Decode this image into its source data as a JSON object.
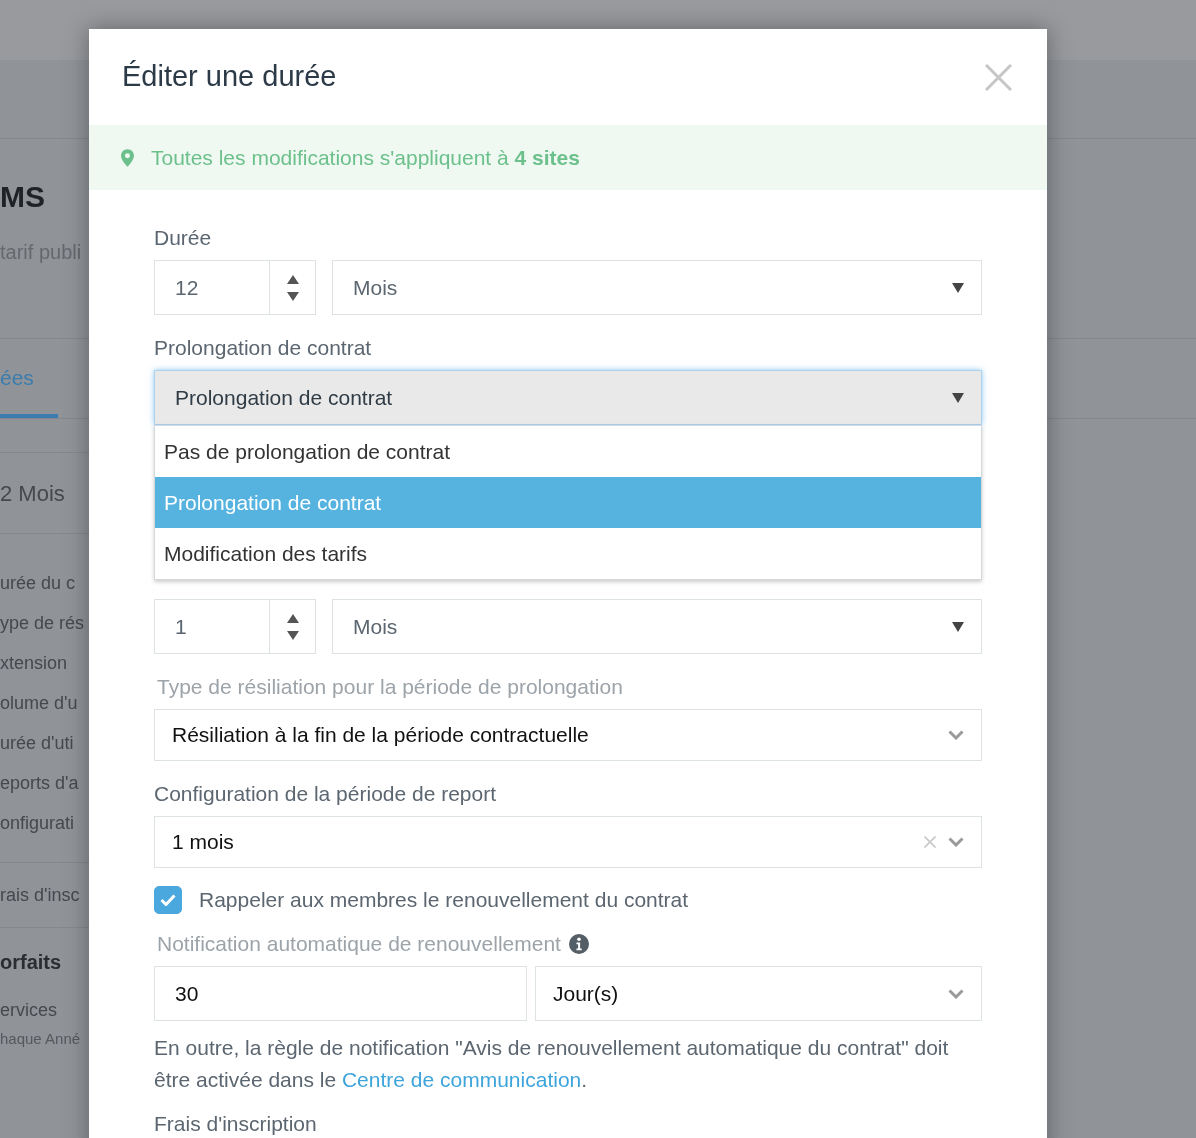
{
  "background": {
    "heading": "MS",
    "subheading": "tarif publi",
    "tab": {
      "label": "ées",
      "selected": true
    },
    "summary": "2 Mois",
    "details": [
      "urée du c",
      "ype de rés",
      "xtension",
      "olume d'u",
      "urée d'uti",
      "eports d'a",
      "onfigurati"
    ],
    "fee": "rais d'insc",
    "section": "orfaits",
    "service": "ervices",
    "service_note": "haque Anné"
  },
  "dialog": {
    "title": "Éditer une durée",
    "banner": "Toutes les modifications s'appliquent à **4 sites**",
    "fields": [
      {
        "kind": "number_unit",
        "label": "Durée",
        "muted": false,
        "value": "12",
        "unit": "Mois"
      },
      {
        "kind": "select_open",
        "label": "Prolongation de contrat",
        "muted": false,
        "value": "Prolongation de contrat",
        "options": [
          {
            "label": "Pas de prolongation de contrat",
            "selected": false
          },
          {
            "label": "Prolongation de contrat",
            "selected": true
          },
          {
            "label": "Modification des tarifs",
            "selected": false
          }
        ]
      },
      {
        "kind": "number_unit",
        "value": "1",
        "unit": "Mois"
      },
      {
        "kind": "select",
        "label": "Type de résiliation pour la période de prolongation",
        "muted": true,
        "value": "Résiliation à la fin de la période contractuelle",
        "clearable": false
      },
      {
        "kind": "select",
        "label": "Configuration de la période de report",
        "muted": false,
        "value": "1 mois",
        "clearable": true
      },
      {
        "kind": "checkbox",
        "label": "Rappeler aux membres le renouvellement du contrat",
        "checked": true
      },
      {
        "kind": "input_unit",
        "label": "Notification automatique de renouvellement",
        "muted": true,
        "info": true,
        "value": "30",
        "unit": "Jour(s)"
      },
      {
        "kind": "note",
        "text": "En outre, la règle de notification \"Avis de renouvellement automatique du contrat\" doit être activée dans le",
        "link": "Centre de communication",
        "end": "."
      },
      {
        "kind": "heading",
        "label": "Frais d'inscription",
        "muted": false
      }
    ]
  }
}
